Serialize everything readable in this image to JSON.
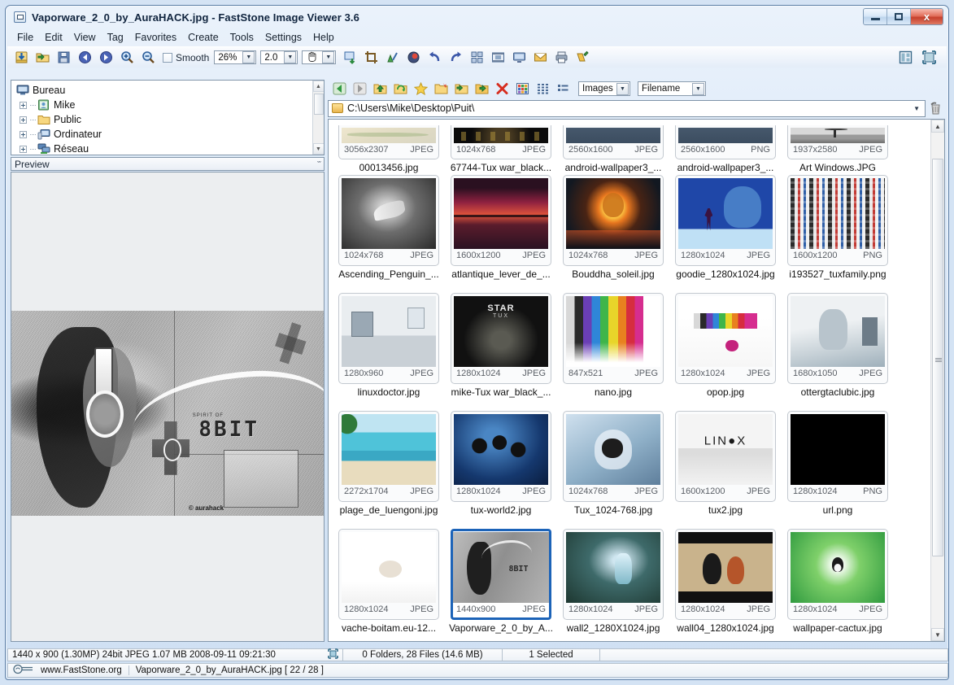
{
  "window": {
    "title": "Vaporware_2_0_by_AuraHACK.jpg  -  FastStone Image Viewer 3.6",
    "minimize_label": "Minimize",
    "maximize_label": "Maximize",
    "close_label": "x"
  },
  "menu": {
    "items": [
      "File",
      "Edit",
      "View",
      "Tag",
      "Favorites",
      "Create",
      "Tools",
      "Settings",
      "Help"
    ]
  },
  "toolbar": {
    "smooth_label": "Smooth",
    "zoom_value": "26%",
    "scale_value": "2.0",
    "hand_value": "",
    "icons": [
      "open-download-icon",
      "open-folder-icon",
      "save-icon",
      "previous-image-icon",
      "next-image-icon",
      "zoom-in-icon",
      "zoom-out-icon",
      "resize-icon",
      "crop-icon",
      "draw-icon",
      "red-eye-icon",
      "undo-icon",
      "redo-icon",
      "thumbnail-view-icon",
      "filmstrip-icon",
      "slideshow-icon",
      "email-icon",
      "print-icon",
      "tag-icon"
    ],
    "right_icons": [
      "split-view-icon",
      "fullscreen-icon"
    ]
  },
  "tree": {
    "items": [
      {
        "label": "Bureau",
        "icon": "desktop-icon",
        "expandable": false,
        "indent": 0
      },
      {
        "label": "Mike",
        "icon": "user-folder-icon",
        "expandable": true,
        "indent": 1
      },
      {
        "label": "Public",
        "icon": "folder-icon",
        "expandable": true,
        "indent": 1
      },
      {
        "label": "Ordinateur",
        "icon": "computer-icon",
        "expandable": true,
        "indent": 1
      },
      {
        "label": "Réseau",
        "icon": "network-icon",
        "expandable": true,
        "indent": 1
      }
    ]
  },
  "preview": {
    "header": "Preview",
    "collapse_glyph": "ˇˇ",
    "art_text": "8BIT",
    "art_subtext": "SPIRIT OF",
    "art_signature": "© aurahack"
  },
  "browser": {
    "nav_icons": [
      "back-icon",
      "forward-icon",
      "up-folder-icon",
      "refresh-icon",
      "favorite-star-icon",
      "new-folder-icon",
      "copy-to-icon",
      "move-to-icon",
      "delete-icon",
      "thumbnail-grid-icon",
      "list-view-icon",
      "detail-view-icon"
    ],
    "filter_value": "Images",
    "sort_value": "Filename",
    "path": "C:\\Users\\Mike\\Desktop\\Puit\\",
    "trash_icon": "trash-icon"
  },
  "thumbnails": [
    {
      "name": "00013456.jpg",
      "dims": "3056x2307",
      "format": "JPEG",
      "selected": false,
      "partial": true,
      "art": "map-paper"
    },
    {
      "name": "67744-Tux war_black...",
      "dims": "1024x768",
      "format": "JPEG",
      "selected": false,
      "partial": true,
      "art": "dark-tux-row"
    },
    {
      "name": "android-wallpaper3_...",
      "dims": "2560x1600",
      "format": "JPEG",
      "selected": false,
      "partial": true,
      "art": "slate-blue"
    },
    {
      "name": "android-wallpaper3_...",
      "dims": "2560x1600",
      "format": "PNG",
      "selected": false,
      "partial": true,
      "art": "slate-blue"
    },
    {
      "name": "Art Windows.JPG",
      "dims": "1937x2580",
      "format": "JPEG",
      "selected": false,
      "partial": true,
      "art": "bw-tower"
    },
    {
      "name": "Ascending_Penguin_...",
      "dims": "1024x768",
      "format": "JPEG",
      "selected": false,
      "partial": false,
      "art": "penguin-wing"
    },
    {
      "name": "atlantique_lever_de_...",
      "dims": "1600x1200",
      "format": "JPEG",
      "selected": false,
      "partial": false,
      "art": "red-sunset"
    },
    {
      "name": "Bouddha_soleil.jpg",
      "dims": "1024x768",
      "format": "JPEG",
      "selected": false,
      "partial": false,
      "art": "buddha-sun"
    },
    {
      "name": "goodie_1280x1024.jpg",
      "dims": "1280x1024",
      "format": "JPEG",
      "selected": false,
      "partial": false,
      "art": "blue-head"
    },
    {
      "name": "i193527_tuxfamily.png",
      "dims": "1600x1200",
      "format": "PNG",
      "selected": false,
      "partial": false,
      "art": "tux-collage"
    },
    {
      "name": "linuxdoctor.jpg",
      "dims": "1280x960",
      "format": "JPEG",
      "selected": false,
      "partial": false,
      "art": "lab-room"
    },
    {
      "name": "mike-Tux war_black_...",
      "dims": "1280x1024",
      "format": "JPEG",
      "selected": false,
      "partial": false,
      "art": "star-tux"
    },
    {
      "name": "nano.jpg",
      "dims": "847x521",
      "format": "JPEG",
      "selected": false,
      "partial": false,
      "art": "nano-drip"
    },
    {
      "name": "opop.jpg",
      "dims": "1280x1024",
      "format": "JPEG",
      "selected": false,
      "partial": false,
      "art": "nano-drip-white"
    },
    {
      "name": "ottergtaclubic.jpg",
      "dims": "1680x1050",
      "format": "JPEG",
      "selected": false,
      "partial": false,
      "art": "otter-gta"
    },
    {
      "name": "plage_de_luengoni.jpg",
      "dims": "2272x1704",
      "format": "JPEG",
      "selected": false,
      "partial": false,
      "art": "beach"
    },
    {
      "name": "tux-world2.jpg",
      "dims": "1280x1024",
      "format": "JPEG",
      "selected": false,
      "partial": false,
      "art": "tux-world"
    },
    {
      "name": "Tux_1024-768.jpg",
      "dims": "1024x768",
      "format": "JPEG",
      "selected": false,
      "partial": false,
      "art": "tux-apple"
    },
    {
      "name": "tux2.jpg",
      "dims": "1600x1200",
      "format": "JPEG",
      "selected": false,
      "partial": false,
      "art": "linux-text"
    },
    {
      "name": "url.png",
      "dims": "1280x1024",
      "format": "PNG",
      "selected": false,
      "partial": false,
      "art": "black"
    },
    {
      "name": "vache-boitam.eu-12...",
      "dims": "1280x1024",
      "format": "JPEG",
      "selected": false,
      "partial": false,
      "art": "white-cow"
    },
    {
      "name": "Vaporware_2_0_by_A...",
      "dims": "1440x900",
      "format": "JPEG",
      "selected": true,
      "partial": false,
      "art": "vaporware"
    },
    {
      "name": "wall2_1280X1024.jpg",
      "dims": "1280x1024",
      "format": "JPEG",
      "selected": false,
      "partial": false,
      "art": "fantasy"
    },
    {
      "name": "wall04_1280x1024.jpg",
      "dims": "1280x1024",
      "format": "JPEG",
      "selected": false,
      "partial": false,
      "art": "blacksad"
    },
    {
      "name": "wallpaper-cactux.jpg",
      "dims": "1280x1024",
      "format": "JPEG",
      "selected": false,
      "partial": false,
      "art": "green-tux"
    }
  ],
  "status": {
    "image_info": "1440 x 900 (1.30MP)   24bit JPEG   1.07 MB   2008-09-11 09:21:30",
    "fit_icon": "fit-screen-icon",
    "files": "0 Folders, 28 Files (14.6 MB)",
    "selected": "1 Selected"
  },
  "bottom": {
    "logo_icon": "faststone-logo-icon",
    "site": "www.FastStone.org",
    "current_file": "Vaporware_2_0_by_AuraHACK.jpg [ 22 / 28 ]"
  },
  "colors": {
    "selection_blue": "#1c63b8",
    "window_border": "#5b7ea6",
    "close_red": "#c6402c"
  }
}
